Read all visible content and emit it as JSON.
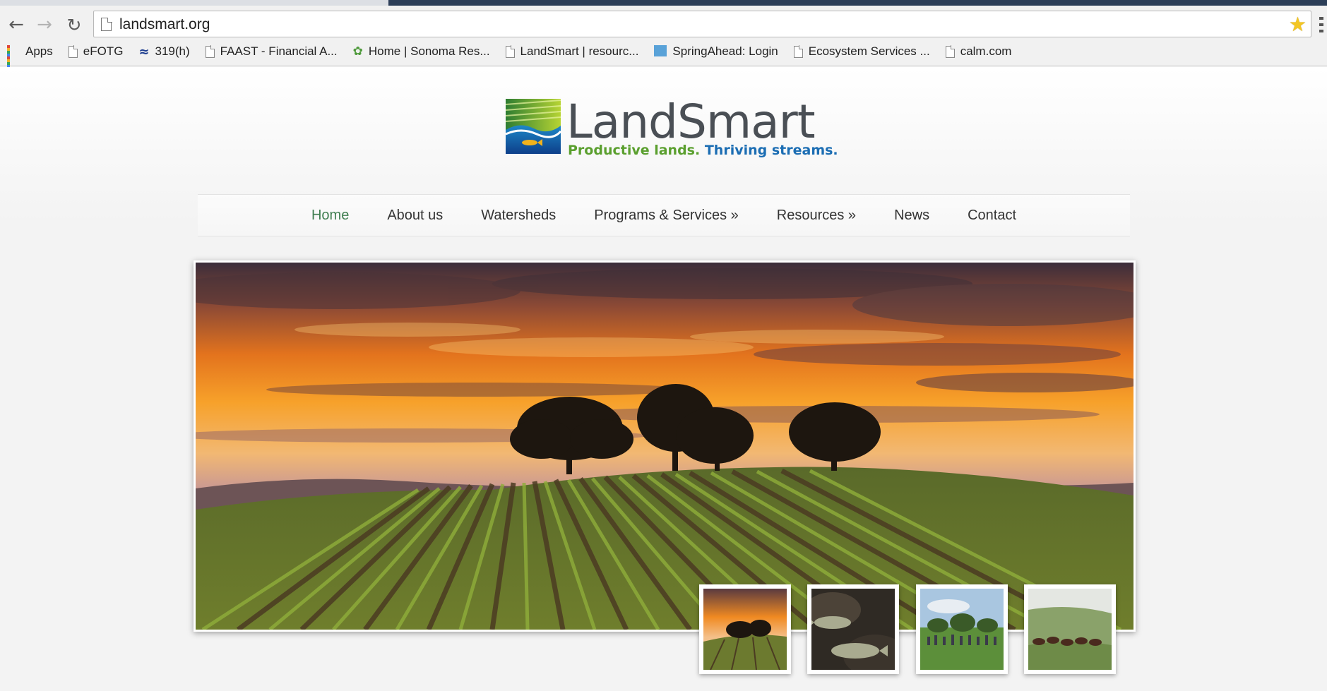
{
  "browser": {
    "url": "landsmart.org",
    "nav": {
      "back_icon": "back-arrow-icon",
      "forward_icon": "forward-arrow-icon",
      "reload_icon": "reload-icon"
    },
    "bookmarks": [
      {
        "label": "Apps",
        "icon": "apps-grid-icon"
      },
      {
        "label": "eFOTG",
        "icon": "page-icon"
      },
      {
        "label": "319(h)",
        "icon": "wave-logo-icon"
      },
      {
        "label": "FAAST - Financial A...",
        "icon": "page-icon"
      },
      {
        "label": "Home | Sonoma Res...",
        "icon": "leaf-icon"
      },
      {
        "label": "LandSmart | resourc...",
        "icon": "page-icon"
      },
      {
        "label": "SpringAhead: Login",
        "icon": "grid-logo-icon"
      },
      {
        "label": "Ecosystem Services ...",
        "icon": "page-icon"
      },
      {
        "label": "calm.com",
        "icon": "page-icon"
      }
    ]
  },
  "site": {
    "logo_word": "LandSmart",
    "tagline_a": "Productive lands.",
    "tagline_b": "Thriving streams.",
    "nav": [
      {
        "label": "Home",
        "active": true
      },
      {
        "label": "About us"
      },
      {
        "label": "Watersheds"
      },
      {
        "label": "Programs & Services »"
      },
      {
        "label": "Resources »"
      },
      {
        "label": "News"
      },
      {
        "label": "Contact"
      }
    ],
    "slider": {
      "thumbnails": [
        "sunset-vineyard",
        "fish-underwater",
        "people-in-field",
        "cattle-on-hill"
      ]
    }
  },
  "colors": {
    "nav_active": "#3f7e50",
    "tagline_green": "#5a9f2e",
    "tagline_blue": "#1b6db3",
    "star": "#f3c623"
  }
}
